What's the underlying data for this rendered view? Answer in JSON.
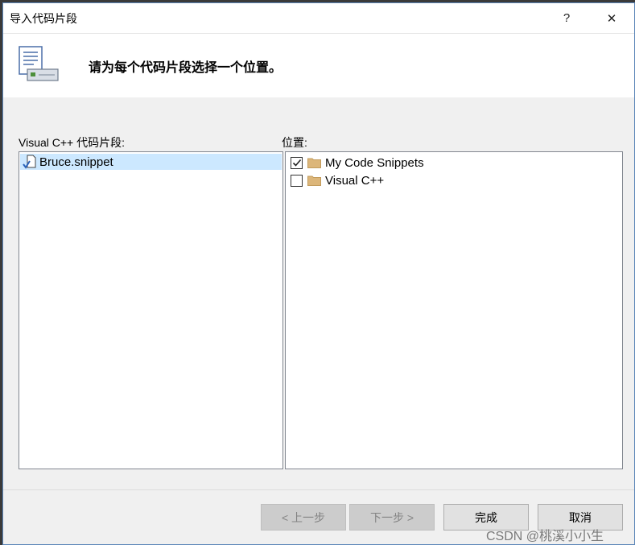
{
  "window": {
    "title": "导入代码片段",
    "help_icon": "?",
    "close_icon": "✕"
  },
  "header": {
    "title": "请为每个代码片段选择一个位置。",
    "icon": "document-snippet-icon"
  },
  "left_panel": {
    "label": "Visual C++ 代码片段:",
    "items": [
      {
        "label": "Bruce.snippet",
        "selected": true,
        "icon": "snippet-file-icon"
      }
    ]
  },
  "right_panel": {
    "label": "位置:",
    "items": [
      {
        "label": "My Code Snippets",
        "checked": true,
        "icon": "folder-icon"
      },
      {
        "label": "Visual C++",
        "checked": false,
        "icon": "folder-icon"
      }
    ]
  },
  "buttons": {
    "prev": "< 上一步",
    "next": "下一步 >",
    "finish": "完成",
    "cancel": "取消"
  },
  "watermark": "CSDN @桃溪小小生",
  "colors": {
    "selection": "#cce8ff",
    "folder": "#dcb67a",
    "frame": "#5c86b8"
  }
}
